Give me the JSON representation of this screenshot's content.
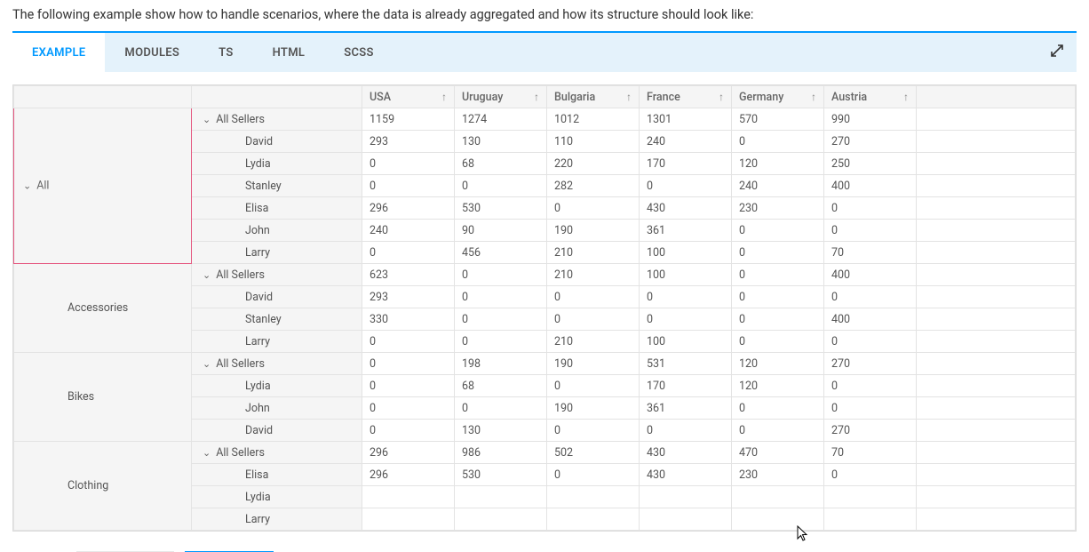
{
  "intro": "The following example show how to handle scenarios, where the data is already aggregated and how its structure should look like:",
  "tabs": [
    {
      "label": "EXAMPLE",
      "active": true
    },
    {
      "label": "MODULES",
      "active": false
    },
    {
      "label": "TS",
      "active": false
    },
    {
      "label": "HTML",
      "active": false
    },
    {
      "label": "SCSS",
      "active": false
    }
  ],
  "all_label": "All",
  "columns": [
    "USA",
    "Uruguay",
    "Bulgaria",
    "France",
    "Germany",
    "Austria"
  ],
  "sort_glyph": "↑",
  "groups": [
    {
      "category": "",
      "category_has_all_highlight": true,
      "rows": [
        {
          "seller": "All Sellers",
          "expandable": true,
          "vals": [
            1159,
            1274,
            1012,
            1301,
            570,
            990
          ]
        },
        {
          "seller": "David",
          "vals": [
            293,
            130,
            110,
            240,
            0,
            270
          ]
        },
        {
          "seller": "Lydia",
          "vals": [
            0,
            68,
            220,
            170,
            120,
            250
          ]
        },
        {
          "seller": "Stanley",
          "vals": [
            0,
            0,
            282,
            0,
            240,
            400
          ]
        },
        {
          "seller": "Elisa",
          "vals": [
            296,
            530,
            0,
            430,
            230,
            0
          ]
        },
        {
          "seller": "John",
          "vals": [
            240,
            90,
            190,
            361,
            0,
            0
          ]
        },
        {
          "seller": "Larry",
          "vals": [
            0,
            456,
            210,
            100,
            0,
            70
          ]
        }
      ]
    },
    {
      "category": "Accessories",
      "rows": [
        {
          "seller": "All Sellers",
          "expandable": true,
          "vals": [
            623,
            0,
            210,
            100,
            0,
            400
          ]
        },
        {
          "seller": "David",
          "vals": [
            293,
            0,
            0,
            0,
            0,
            0
          ]
        },
        {
          "seller": "Stanley",
          "vals": [
            330,
            0,
            0,
            0,
            0,
            400
          ]
        },
        {
          "seller": "Larry",
          "vals": [
            0,
            0,
            210,
            100,
            0,
            0
          ]
        }
      ]
    },
    {
      "category": "Bikes",
      "rows": [
        {
          "seller": "All Sellers",
          "expandable": true,
          "vals": [
            0,
            198,
            190,
            531,
            120,
            270
          ]
        },
        {
          "seller": "Lydia",
          "vals": [
            0,
            68,
            0,
            170,
            120,
            0
          ]
        },
        {
          "seller": "John",
          "vals": [
            0,
            0,
            190,
            361,
            0,
            0
          ]
        },
        {
          "seller": "David",
          "vals": [
            0,
            130,
            0,
            0,
            0,
            270
          ]
        }
      ]
    },
    {
      "category": "Clothing",
      "rows": [
        {
          "seller": "All Sellers",
          "expandable": true,
          "vals": [
            296,
            986,
            502,
            430,
            470,
            70
          ]
        },
        {
          "seller": "Elisa",
          "vals": [
            296,
            530,
            0,
            430,
            230,
            0
          ]
        },
        {
          "seller": "Lydia",
          "vals": [
            "",
            "",
            "",
            "",
            "",
            ""
          ]
        },
        {
          "seller": "Larry",
          "vals": [
            "",
            "",
            "",
            "",
            "",
            ""
          ]
        }
      ]
    }
  ]
}
